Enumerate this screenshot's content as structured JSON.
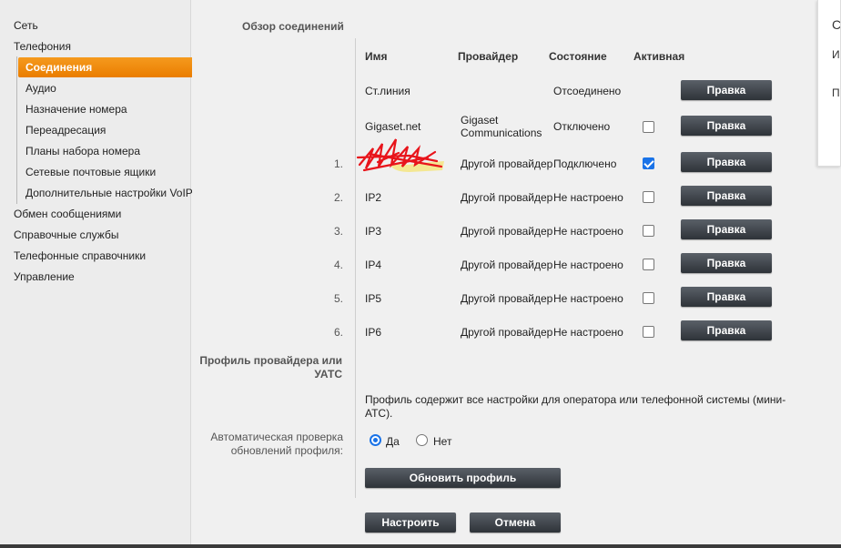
{
  "nav": {
    "items": [
      {
        "label": "Сеть"
      },
      {
        "label": "Телефония"
      },
      {
        "label": "Обмен сообщениями"
      },
      {
        "label": "Справочные службы"
      },
      {
        "label": "Телефонные справочники"
      },
      {
        "label": "Управление"
      }
    ],
    "sub_items": [
      {
        "label": "Соединения",
        "active": true
      },
      {
        "label": "Аудио"
      },
      {
        "label": "Назначение номера"
      },
      {
        "label": "Переадресация"
      },
      {
        "label": "Планы набора номера"
      },
      {
        "label": "Сетевые почтовые ящики"
      },
      {
        "label": "Дополнительные настройки VoIP"
      }
    ]
  },
  "overview": {
    "title": "Обзор соединений",
    "headers": {
      "name": "Имя",
      "provider": "Провайдер",
      "state": "Состояние",
      "active": "Активная"
    },
    "rows": [
      {
        "num": "",
        "name": "Ст.линия",
        "provider": "",
        "state": "Отсоединено",
        "active": null,
        "edit": "Правка"
      },
      {
        "num": "",
        "name": "Gigaset.net",
        "provider": "Gigaset Communications",
        "state": "Отключено",
        "active": false,
        "edit": "Правка"
      },
      {
        "num": "1.",
        "name": "",
        "provider": "Другой провайдер",
        "state": "Подключено",
        "active": true,
        "edit": "Правка"
      },
      {
        "num": "2.",
        "name": "IP2",
        "provider": "Другой провайдер",
        "state": "Не настроено",
        "active": false,
        "edit": "Правка"
      },
      {
        "num": "3.",
        "name": "IP3",
        "provider": "Другой провайдер",
        "state": "Не настроено",
        "active": false,
        "edit": "Правка"
      },
      {
        "num": "4.",
        "name": "IP4",
        "provider": "Другой провайдер",
        "state": "Не настроено",
        "active": false,
        "edit": "Правка"
      },
      {
        "num": "5.",
        "name": "IP5",
        "provider": "Другой провайдер",
        "state": "Не настроено",
        "active": false,
        "edit": "Правка"
      },
      {
        "num": "6.",
        "name": "IP6",
        "provider": "Другой провайдер",
        "state": "Не настроено",
        "active": false,
        "edit": "Правка"
      }
    ]
  },
  "profile": {
    "title_line1": "Профиль провайдера или",
    "title_line2": "УАТС",
    "description_line1": "Профиль содержит все настройки для оператора или телефонной системы (мини-",
    "description_line2": "АТС).",
    "auto_check_label_line1": "Автоматическая проверка",
    "auto_check_label_line2": "обновлений профиля:",
    "option_yes": "Да",
    "option_no": "Нет",
    "selected": "yes",
    "update_button": "Обновить профиль"
  },
  "footer": {
    "apply_button": "Настроить",
    "cancel_button": "Отмена"
  },
  "overlay": {
    "line1": "С",
    "line2": "И",
    "line3": "П"
  },
  "colors": {
    "accent": "#ea7d00",
    "button": "#3a3f45",
    "checkbox": "#1a73e8"
  }
}
